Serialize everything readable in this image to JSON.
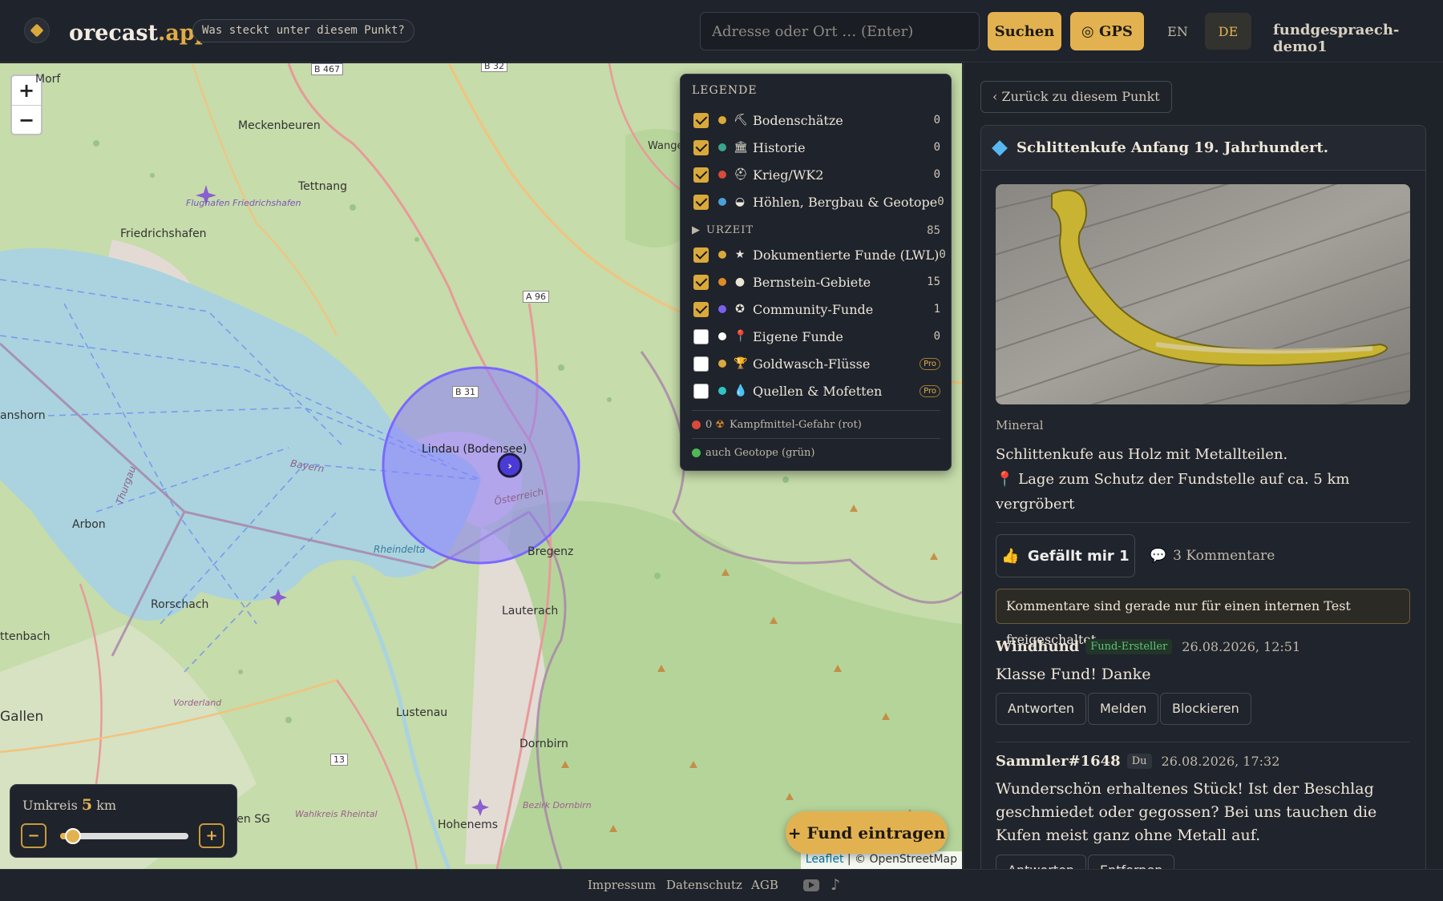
{
  "header": {
    "brand_main": "orecast",
    "brand_accent": ".app",
    "tagline": "Was steckt unter diesem Punkt?",
    "search_placeholder": "Adresse oder Ort … (Enter)",
    "search_button": "Suchen",
    "gps_button": "◎ GPS",
    "lang_en": "EN",
    "lang_de": "DE",
    "active_lang": "DE",
    "user": "fundgespraech-demo1"
  },
  "map": {
    "zoom_in": "+",
    "zoom_out": "−",
    "place_labels": [
      "Meckenbeuren",
      "Tettnang",
      "Friedrichshafen",
      "Flughafen Friedrichshafen",
      "Lindau (Bodensee)",
      "Bregenz",
      "Lauterach",
      "Arbon",
      "Rorschach",
      "Lustenau",
      "Dornbirn",
      "Hohenems",
      "Rheindelta",
      "Altstätten SG",
      "Wahlkreis Rheintal",
      "Bezirk Dornbirn",
      "Vorderland",
      "Gallen",
      "ttenbach",
      "anshorn",
      "Thurgau",
      "Bayern",
      "Österreich",
      "Wangen im Allgäu",
      "Morf"
    ],
    "road_labels": [
      "B 467",
      "B 32",
      "A 96",
      "B 31",
      "13"
    ],
    "attribution_leaflet": "Leaflet",
    "attribution_rest": "| © OpenStreetMap"
  },
  "legend": {
    "title": "LEGENDE",
    "items_top": [
      {
        "icon": "rock-icon",
        "glyph": "⛏",
        "label": "Bodenschätze",
        "count": "0",
        "checked": true,
        "color": "#d9a93b"
      },
      {
        "icon": "museum-icon",
        "glyph": "🏛",
        "label": "Historie",
        "count": "0",
        "checked": true,
        "color": "#3aa58a"
      },
      {
        "icon": "helmet-icon",
        "glyph": "⛑",
        "label": "Krieg/WK2",
        "count": "0",
        "checked": true,
        "color": "#d84a3a"
      },
      {
        "icon": "cave-icon",
        "glyph": "◒",
        "label": "Höhlen, Bergbau & Geotope",
        "count": "0",
        "checked": true,
        "color": "#4aa0d8"
      }
    ],
    "group_label": "URZEIT",
    "group_count": "85",
    "items_bottom": [
      {
        "icon": "star-icon",
        "glyph": "★",
        "label": "Dokumentierte Funde (LWL)",
        "count": "0",
        "checked": true,
        "color": "#d9a93b"
      },
      {
        "icon": "amber-icon",
        "glyph": "●",
        "label": "Bernstein-Gebiete",
        "count": "15",
        "checked": true,
        "color": "#e08a2a"
      },
      {
        "icon": "compass-icon",
        "glyph": "✪",
        "label": "Community-Funde",
        "count": "1",
        "checked": true,
        "color": "#7b5ff0"
      },
      {
        "icon": "pin-icon",
        "glyph": "📍",
        "label": "Eigene Funde",
        "count": "0",
        "checked": false,
        "color": "#ffffff"
      },
      {
        "icon": "trophy-icon",
        "glyph": "🏆",
        "label": "Goldwasch-Flüsse",
        "count": "Pro",
        "checked": false,
        "color": "#d9a93b"
      },
      {
        "icon": "droplet-icon",
        "glyph": "💧",
        "label": "Quellen & Mofetten",
        "count": "Pro",
        "checked": false,
        "color": "#2ec4c4"
      }
    ],
    "note1_count": "0",
    "note1_text": "Kampfmittel-Gefahr (rot)",
    "note2_text": "auch Geotope (grün)",
    "colors": {
      "danger": "#d84a3a",
      "geo": "#4fb858"
    }
  },
  "radius": {
    "label": "Umkreis",
    "value": "5",
    "unit": "km",
    "minus": "−",
    "plus": "+",
    "slider_fraction": 0.1
  },
  "fab_label": "+ Fund eintragen",
  "panel": {
    "back_label": "‹ Zurück zu diesem Punkt",
    "find_title": "Schlittenkufe Anfang 19. Jahrhundert.",
    "category": "Mineral",
    "description": "Schlittenkufe aus Holz mit Metallteilen.",
    "location_note": "📍  Lage zum Schutz der Fundstelle auf ca. 5 km vergröbert",
    "like_label": "Gefällt mir 1",
    "comments_label": "3 Kommentare",
    "notice": "Kommentare sind gerade nur für einen internen Test freigeschaltet.",
    "comments": [
      {
        "author": "Windhund",
        "badge": "Fund-Ersteller",
        "time": "26.08.2026, 12:51",
        "text": "Klasse Fund! Danke",
        "actions": [
          "Antworten",
          "Melden",
          "Blockieren"
        ]
      },
      {
        "author": "Sammler#1648",
        "badge": "Du",
        "time": "26.08.2026, 17:32",
        "text": "Wunderschön erhaltenes Stück! Ist der Beschlag geschmiedet oder gegossen? Bei uns tauchen die Kufen meist ganz ohne Metall auf.",
        "actions": [
          "Antworten",
          "Entfernen"
        ]
      }
    ]
  },
  "footer": {
    "links": [
      "Impressum",
      "Datenschutz",
      "AGB"
    ],
    "social_icons": [
      "youtube-icon",
      "tiktok-icon"
    ]
  },
  "colors": {
    "accent": "#e3b250",
    "background": "#1e2229",
    "water": "#aad3df",
    "radius_circle": "#8a7bff"
  }
}
